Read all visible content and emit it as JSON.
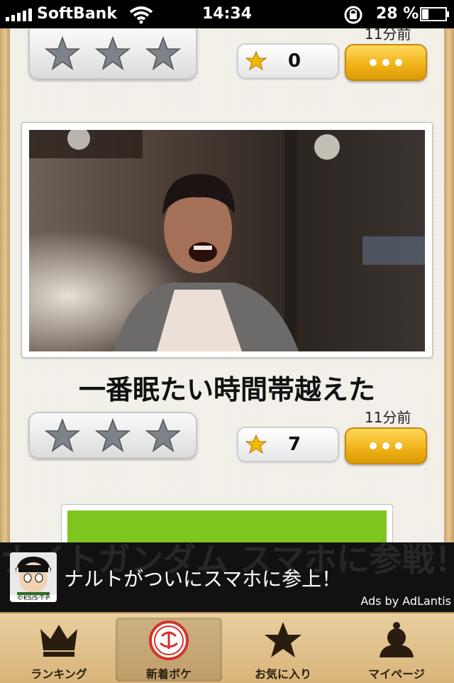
{
  "status_bar": {
    "carrier": "SoftBank",
    "time": "14:34",
    "battery_percent": "28 %",
    "battery_level": 0.28
  },
  "posts": [
    {
      "time_ago": "11分前",
      "favorite_count": "0"
    },
    {
      "caption": "一番眠たい時間帯越えた",
      "time_ago": "11分前",
      "favorite_count": "7"
    }
  ],
  "ad": {
    "headline": "ナルトがついにスマホに参上！",
    "credit": "Ads by AdLantis",
    "avatar_caption": "©KS/S·T·P",
    "background_text": "ナイトガンダム スマホに参戦！"
  },
  "tabs": [
    {
      "label": "ランキング",
      "icon": "crown-icon"
    },
    {
      "label": "新着ボケ",
      "icon": "boke-badge-icon"
    },
    {
      "label": "お気に入り",
      "icon": "star-icon"
    },
    {
      "label": "マイページ",
      "icon": "person-icon"
    }
  ],
  "colors": {
    "accent_gold": "#f0b116",
    "wood": "#d8b47a"
  }
}
